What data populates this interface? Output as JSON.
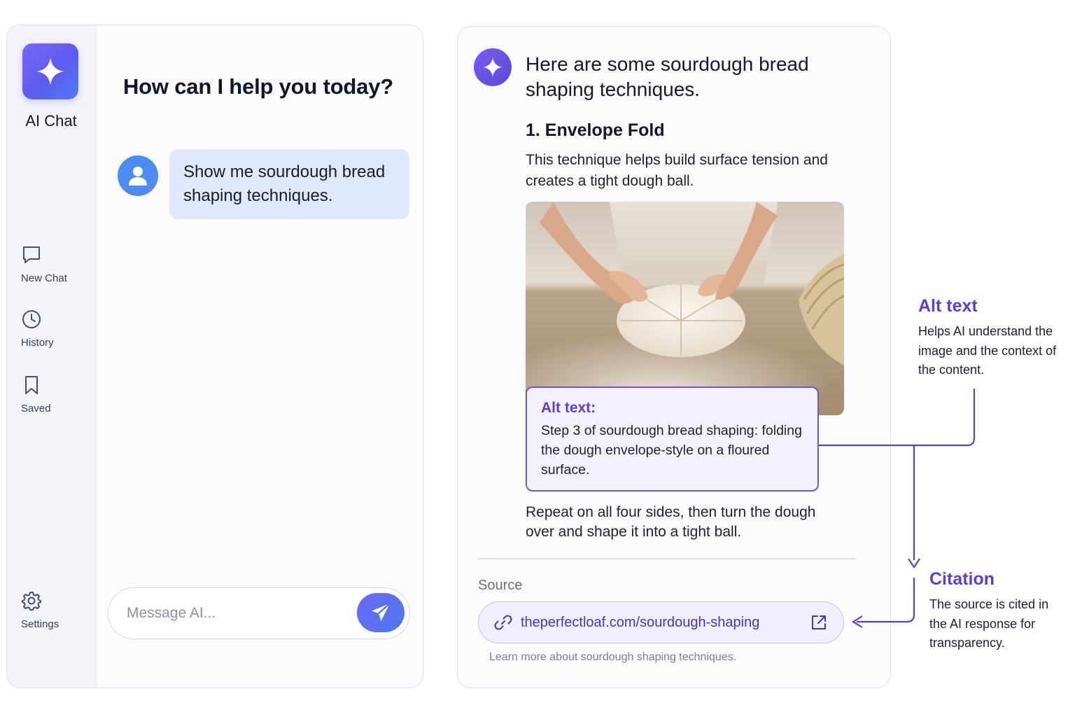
{
  "sidebar": {
    "app_name": "AI Chat",
    "items": [
      {
        "label": "New Chat",
        "icon": "chat-bubble-icon"
      },
      {
        "label": "History",
        "icon": "clock-icon"
      },
      {
        "label": "Saved",
        "icon": "bookmark-icon"
      },
      {
        "label": "Settings",
        "icon": "gear-icon"
      }
    ]
  },
  "chat": {
    "greeting": "How can I help you today?",
    "user_message": "Show me sourdough bread shaping techniques.",
    "composer_placeholder": "Message AI..."
  },
  "response": {
    "intro": "Here are some sourdough bread shaping techniques.",
    "step_title": "1. Envelope Fold",
    "step_description": "This technique helps build surface tension and creates a tight dough ball.",
    "alt_text_label": "Alt text:",
    "alt_text_body": "Step 3 of sourdough bread shaping: folding the dough envelope-style on a floured surface.",
    "step_followup": "Repeat on all four sides, then turn the dough over and shape it into a tight ball.",
    "source_label": "Source",
    "source_link": "theperfectloaf.com/sourdough-shaping",
    "source_note": "Learn more about sourdough shaping techniques."
  },
  "annotations": {
    "alt_text": {
      "title": "Alt text",
      "body": "Helps AI understand the image and the context of the content."
    },
    "citation": {
      "title": "Citation",
      "body": "The source is cited in the AI response for transparency."
    }
  },
  "colors": {
    "accent": "#5a3fd0",
    "brand_gradient_start": "#7a68f5",
    "brand_gradient_end": "#4f7cf4",
    "user_avatar": "#4a8cf1",
    "user_bubble": "#dfe8fd"
  }
}
